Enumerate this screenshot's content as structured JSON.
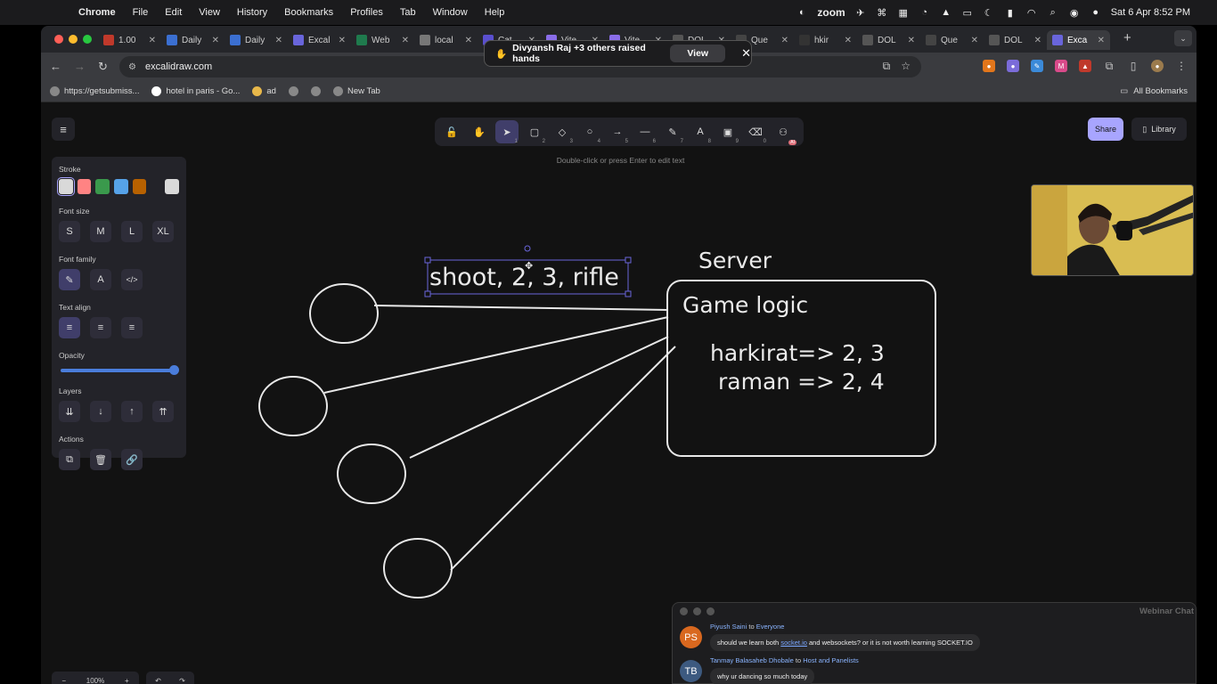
{
  "menubar": {
    "app": "Chrome",
    "items": [
      "File",
      "Edit",
      "View",
      "History",
      "Bookmarks",
      "Profiles",
      "Tab",
      "Window",
      "Help"
    ],
    "status_app": "zoom",
    "datetime": "Sat 6 Apr  8:52 PM"
  },
  "tabs": [
    {
      "title": "1.00",
      "color": "#c0392b"
    },
    {
      "title": "Daily",
      "color": "#3b6fd1"
    },
    {
      "title": "Daily",
      "color": "#3b6fd1"
    },
    {
      "title": "Excal",
      "color": "#6965db"
    },
    {
      "title": "Web",
      "color": "#1f7a4d"
    },
    {
      "title": "local",
      "color": "#777777"
    },
    {
      "title": "Cat",
      "color": "#5a4fcf"
    },
    {
      "title": "Vite",
      "color": "#8a6de9"
    },
    {
      "title": "Vite",
      "color": "#8a6de9"
    },
    {
      "title": "DOL",
      "color": "#555555"
    },
    {
      "title": "Que",
      "color": "#444444"
    },
    {
      "title": "hkir",
      "color": "#333333"
    },
    {
      "title": "DOL",
      "color": "#555555"
    },
    {
      "title": "Que",
      "color": "#444444"
    },
    {
      "title": "DOL",
      "color": "#555555"
    },
    {
      "title": "Exca",
      "color": "#6965db",
      "active": true
    }
  ],
  "address": {
    "url": "excalidraw.com"
  },
  "bookmarks": [
    "https://getsubmiss...",
    "hotel in paris - Go...",
    "ad",
    "",
    "",
    "New Tab"
  ],
  "all_bookmarks": "All Bookmarks",
  "zoom_banner": {
    "text": "Divyansh Raj +3 others raised hands",
    "button": "View"
  },
  "excalidraw": {
    "hint": "Double-click or press Enter to edit text",
    "share": "Share",
    "library": "Library",
    "tools": [
      {
        "icon": "lock-icon",
        "glyph": "🔓",
        "key": ""
      },
      {
        "icon": "hand-icon",
        "glyph": "✋",
        "key": ""
      },
      {
        "icon": "selection-icon",
        "glyph": "➤",
        "key": "1",
        "active": true
      },
      {
        "icon": "rectangle-icon",
        "glyph": "▢",
        "key": "2"
      },
      {
        "icon": "diamond-icon",
        "glyph": "◇",
        "key": "3"
      },
      {
        "icon": "ellipse-icon",
        "glyph": "○",
        "key": "4"
      },
      {
        "icon": "arrow-icon",
        "glyph": "→",
        "key": "5"
      },
      {
        "icon": "line-icon",
        "glyph": "—",
        "key": "6"
      },
      {
        "icon": "pencil-icon",
        "glyph": "✎",
        "key": "7"
      },
      {
        "icon": "text-icon",
        "glyph": "A",
        "key": "8"
      },
      {
        "icon": "image-icon",
        "glyph": "▣",
        "key": "9"
      },
      {
        "icon": "eraser-icon",
        "glyph": "⌫",
        "key": "0"
      },
      {
        "icon": "ai-shapes-icon",
        "glyph": "⚇",
        "key": "",
        "badge": "AI"
      }
    ],
    "properties": {
      "stroke_label": "Stroke",
      "stroke_colors": [
        "#d9d9d9",
        "#ff8383",
        "#3a994c",
        "#56a2e8",
        "#b76100",
        "#d9d9d9"
      ],
      "font_size_label": "Font size",
      "font_sizes": [
        "S",
        "M",
        "L",
        "XL"
      ],
      "font_family_label": "Font family",
      "text_align_label": "Text align",
      "opacity_label": "Opacity",
      "opacity_value": 1.0,
      "layers_label": "Layers",
      "actions_label": "Actions"
    },
    "drawing": {
      "selected_text": "shoot, 2, 3, rifle",
      "server_label": "Server",
      "box_title": "Game logic",
      "box_line1": "harkirat=> 2, 3",
      "box_line2": "raman => 2, 4"
    },
    "zoom_level": "100%"
  },
  "chat": {
    "title": "Webinar Chat",
    "messages": [
      {
        "initials": "PS",
        "avatar_color": "#d9681f",
        "sender": "Piyush Saini",
        "to_word": "to",
        "recipient": "Everyone",
        "text_before": "should we learn both ",
        "link": "socket.io",
        "text_after": " and websockets? or it is not worth learning SOCKET.IO"
      },
      {
        "initials": "TB",
        "avatar_color": "#3d5a80",
        "sender": "Tanmay Balasaheb Dhobale",
        "to_word": "to",
        "recipient": "Host and Panelists",
        "text": "why ur dancing so much today"
      }
    ]
  }
}
